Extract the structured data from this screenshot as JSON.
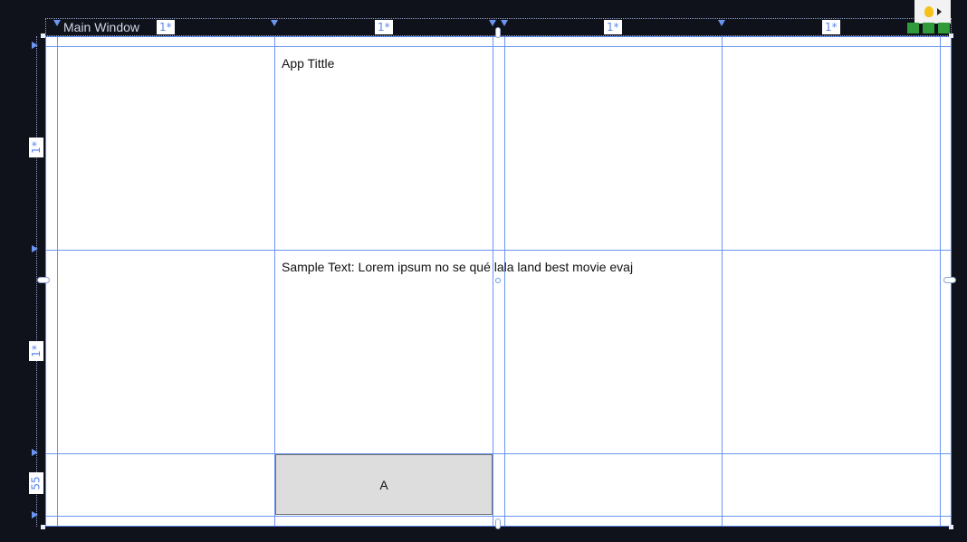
{
  "window": {
    "title": "Main Window",
    "app_title": "App Tittle",
    "sample_text": "Sample Text: Lorem ipsum no se qué lala land best movie evaj",
    "button_label": "A"
  },
  "grid": {
    "columns": [
      "1*",
      "1*",
      "1*",
      "1*"
    ],
    "rows": [
      "1*",
      "1*",
      "55"
    ]
  },
  "colors": {
    "accent": "#6b95f2",
    "background": "#0f121a",
    "button_bg": "#dddddd",
    "bulb": "#f4c21a",
    "status_green": "#2f9b3a"
  },
  "icons": {
    "bulb": "lightbulb-icon",
    "expand": "caret-right-icon"
  }
}
